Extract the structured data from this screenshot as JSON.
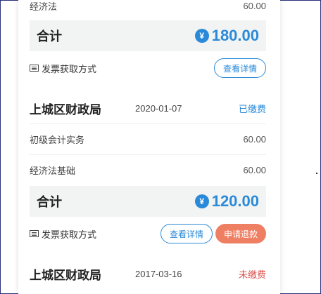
{
  "groups": [
    {
      "items": [
        {
          "name": "经济法",
          "amount": "60.00"
        }
      ],
      "total_label": "合计",
      "yen": "¥",
      "total": "180.00",
      "invoice_label": "发票获取方式",
      "details_button": "查看详情"
    },
    {
      "agency": "上城区财政局",
      "date": "2020-01-07",
      "status": "已缴费",
      "items": [
        {
          "name": "初级会计实务",
          "amount": "60.00"
        },
        {
          "name": "经济法基础",
          "amount": "60.00"
        }
      ],
      "total_label": "合计",
      "yen": "¥",
      "total": "120.00",
      "invoice_label": "发票获取方式",
      "details_button": "查看详情",
      "refund_button": "申请退款"
    },
    {
      "agency": "上城区财政局",
      "date": "2017-03-16",
      "status": "未缴费"
    }
  ]
}
